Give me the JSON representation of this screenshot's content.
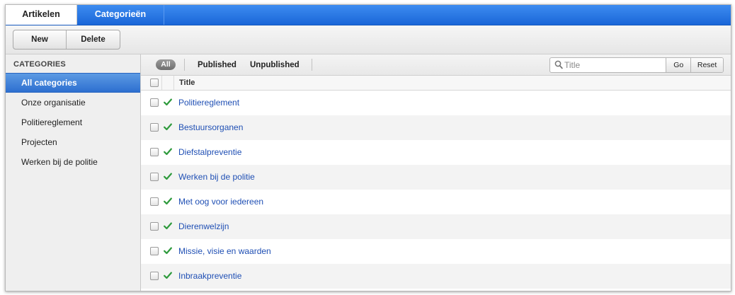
{
  "tabs": {
    "active": "Artikelen",
    "inactive": "Categorieën"
  },
  "toolbar": {
    "new_label": "New",
    "delete_label": "Delete"
  },
  "sidebar": {
    "header": "CATEGORIES",
    "items": [
      {
        "label": "All categories",
        "active": true
      },
      {
        "label": "Onze organisatie"
      },
      {
        "label": "Politiereglement"
      },
      {
        "label": "Projecten"
      },
      {
        "label": "Werken bij de politie"
      }
    ]
  },
  "filters": {
    "all": "All",
    "published": "Published",
    "unpublished": "Unpublished"
  },
  "search": {
    "placeholder": "Title",
    "go": "Go",
    "reset": "Reset"
  },
  "table": {
    "title_header": "Title",
    "rows": [
      {
        "title": "Politiereglement",
        "status": "published"
      },
      {
        "title": "Bestuursorganen",
        "status": "published"
      },
      {
        "title": "Diefstalpreventie",
        "status": "published"
      },
      {
        "title": "Werken bij de politie",
        "status": "published"
      },
      {
        "title": "Met oog voor iedereen",
        "status": "published"
      },
      {
        "title": "Dierenwelzijn",
        "status": "published"
      },
      {
        "title": "Missie, visie en waarden",
        "status": "published"
      },
      {
        "title": "Inbraakpreventie",
        "status": "published"
      }
    ]
  },
  "colors": {
    "tab_bar": "#2a78e4",
    "selection": "#3a7fd8",
    "link": "#1f4fb4",
    "check": "#2e9a3c"
  },
  "icons": {
    "search": "magnifier-icon",
    "status": "checkmark-icon"
  }
}
